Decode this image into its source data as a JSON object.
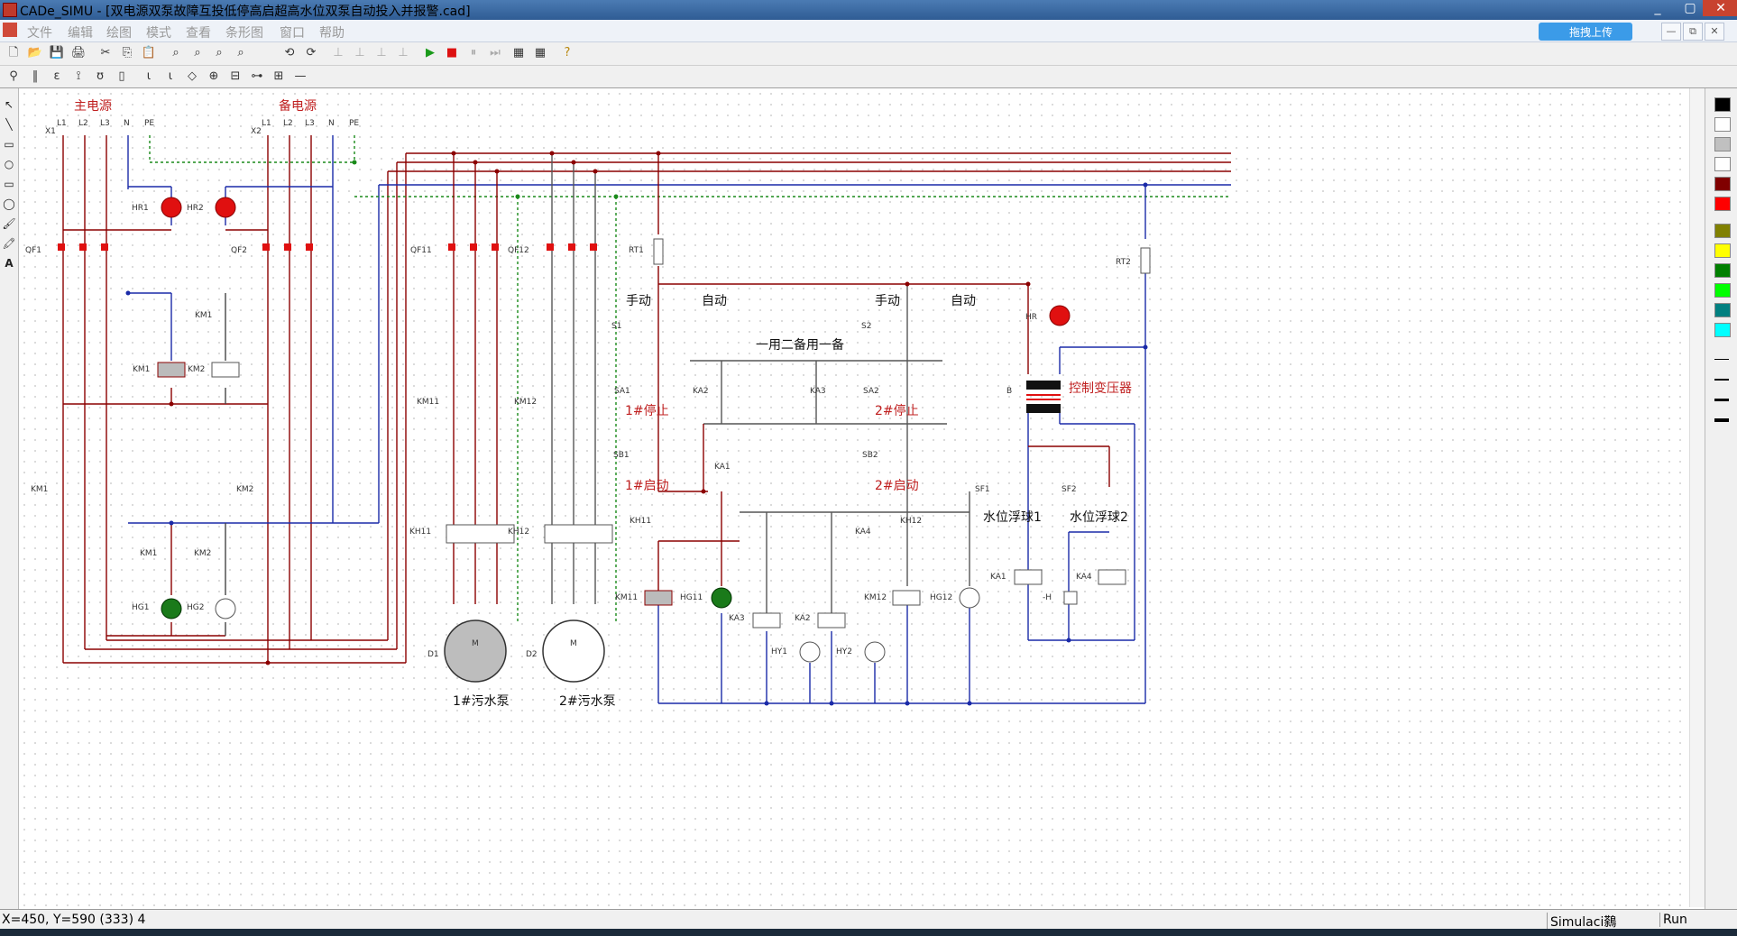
{
  "window": {
    "title": "CADe_SIMU - [双电源双泵故障互投低停高启超高水位双泵自动投入并报警.cad]",
    "controls": [
      "_",
      "▢",
      "✕"
    ]
  },
  "menu": {
    "items": [
      "文件",
      "编辑",
      "绘图",
      "模式",
      "查看",
      "条形图",
      "窗口",
      "帮助"
    ],
    "upload_label": "拖拽上传",
    "mdi_controls": [
      "—",
      "⧉",
      "✕"
    ]
  },
  "toolbar1": [
    "🗋",
    "📂",
    "💾",
    "🖨",
    "✂",
    "⎘",
    "📋",
    "⌕",
    "⌕",
    "⌕",
    "⌕",
    "⟲",
    "⟳",
    "⊥",
    "⊥",
    "⊥",
    "⊥",
    "▶",
    "■",
    "⏸",
    "⏭",
    "▦",
    "▦",
    "?"
  ],
  "toolbar2": [
    "⚲",
    "‖",
    "ɛ",
    "⟟",
    "ʊ",
    "▯",
    "ɩ",
    "ɩ",
    "◇",
    "⊕",
    "⊟",
    "⊶",
    "⊞",
    "—"
  ],
  "tools_left": [
    "↖",
    "╲",
    "▭",
    "○",
    "▭",
    "◯",
    "🖌",
    "🖍",
    "A"
  ],
  "palette": {
    "colors": [
      "#000000",
      "#ffffff",
      "#c0c0c0",
      "#ffffff",
      "#800000",
      "#ff0000",
      "#808000",
      "#ffff00",
      "#008000",
      "#00ff00",
      "#008080",
      "#00ffff"
    ]
  },
  "schematic": {
    "labels": {
      "main_power": "主电源",
      "backup_power": "备电源",
      "manual1": "手动",
      "auto1": "自动",
      "manual2": "手动",
      "auto2": "自动",
      "one_use_one_spare": "一用二备用一备",
      "stop1": "1#停止",
      "start1": "1#启动",
      "stop2": "2#停止",
      "start2": "2#启动",
      "transformer": "控制变压器",
      "float1": "水位浮球1",
      "float2": "水位浮球2",
      "pump1": "1#污水泵",
      "pump2": "2#污水泵"
    },
    "terminals": {
      "x1": "X1",
      "x2": "X2",
      "l1": "L1",
      "l2": "L2",
      "l3": "L3",
      "n": "N",
      "pe": "PE"
    },
    "devices": [
      "HR1",
      "HR2",
      "QF1",
      "QF2",
      "KM1",
      "KM2",
      "KM1",
      "KM2",
      "HG1",
      "HG2",
      "HG1",
      "HG2",
      "QF11",
      "QF12",
      "KM11",
      "KM12",
      "KH11",
      "KH12",
      "D1",
      "D2",
      "RT1",
      "RT2",
      "S1",
      "S2",
      "SA1",
      "SA2",
      "KA2",
      "KA3",
      "SB1",
      "SB2",
      "KA1",
      "KH11",
      "KH12",
      "KA4",
      "HG11",
      "HG12",
      "KM11",
      "KM12",
      "KA3",
      "KA2",
      "HY1",
      "HY2",
      "HR",
      "B",
      "SF1",
      "SF2",
      "KA1",
      "KA4",
      "-H",
      "M",
      "M"
    ]
  },
  "status": {
    "coords": "X=450, Y=590 (333) 4",
    "mode": "Simulaci鷋",
    "state": "Run"
  }
}
